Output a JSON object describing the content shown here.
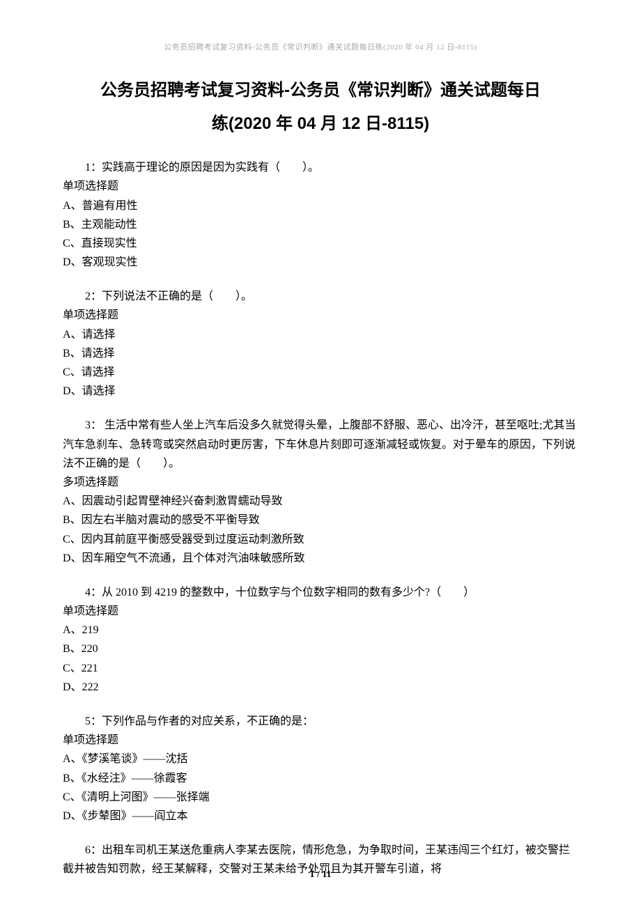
{
  "header": "公务员招聘考试复习资料-公务员《常识判断》通关试题每日练(2020 年 04 月 12 日-8115)",
  "title": "公务员招聘考试复习资料-公务员《常识判断》通关试题每日",
  "subtitle": "练(2020 年 04 月 12 日-8115)",
  "questions": [
    {
      "num": "1：",
      "text": "实践高于理论的原因是因为实践有（　　）。",
      "type": "单项选择题",
      "options": [
        "A、普遍有用性",
        "B、主观能动性",
        "C、直接现实性",
        "D、客观现实性"
      ]
    },
    {
      "num": "2：",
      "text": "下列说法不正确的是（　　）。",
      "type": "单项选择题",
      "options": [
        "A、请选择",
        "B、请选择",
        "C、请选择",
        "D、请选择"
      ]
    },
    {
      "num": "3：",
      "text": " 生活中常有些人坐上汽车后没多久就觉得头晕，上腹部不舒服、恶心、出冷汗，甚至呕吐;尤其当汽车急刹车、急转弯或突然启动时更厉害，下车休息片刻即可逐渐减轻或恢复。对于晕车的原因，下列说法不正确的是（　　）。",
      "type": "多项选择题",
      "options": [
        "A、因震动引起胃壁神经兴奋刺激胃蠕动导致",
        "B、因左右半脑对震动的感受不平衡导致",
        "C、因内耳前庭平衡感受器受到过度运动刺激所致",
        "D、因车厢空气不流通，且个体对汽油味敏感所致"
      ]
    },
    {
      "num": "4：",
      "text": "从 2010 到 4219 的整数中，十位数字与个位数字相同的数有多少个?（　　）",
      "type": "单项选择题",
      "options": [
        "A、219",
        "B、220",
        "C、221",
        "D、222"
      ]
    },
    {
      "num": "5：",
      "text": "下列作品与作者的对应关系，不正确的是：",
      "type": "单项选择题",
      "options": [
        "A、《梦溪笔谈》——沈括",
        "B、《水经注》——徐霞客",
        "C、《清明上河图》——张择端",
        "D、《步辇图》——阎立本"
      ]
    },
    {
      "num": "6：",
      "text": "出租车司机王某送危重病人李某去医院，情形危急，为争取时间，王某违闯三个红灯，被交警拦截并被告知罚款，经王某解释，交警对王某未给予处罚且为其开警车引道，将",
      "type": "",
      "options": []
    }
  ],
  "footer": "1 / 11"
}
